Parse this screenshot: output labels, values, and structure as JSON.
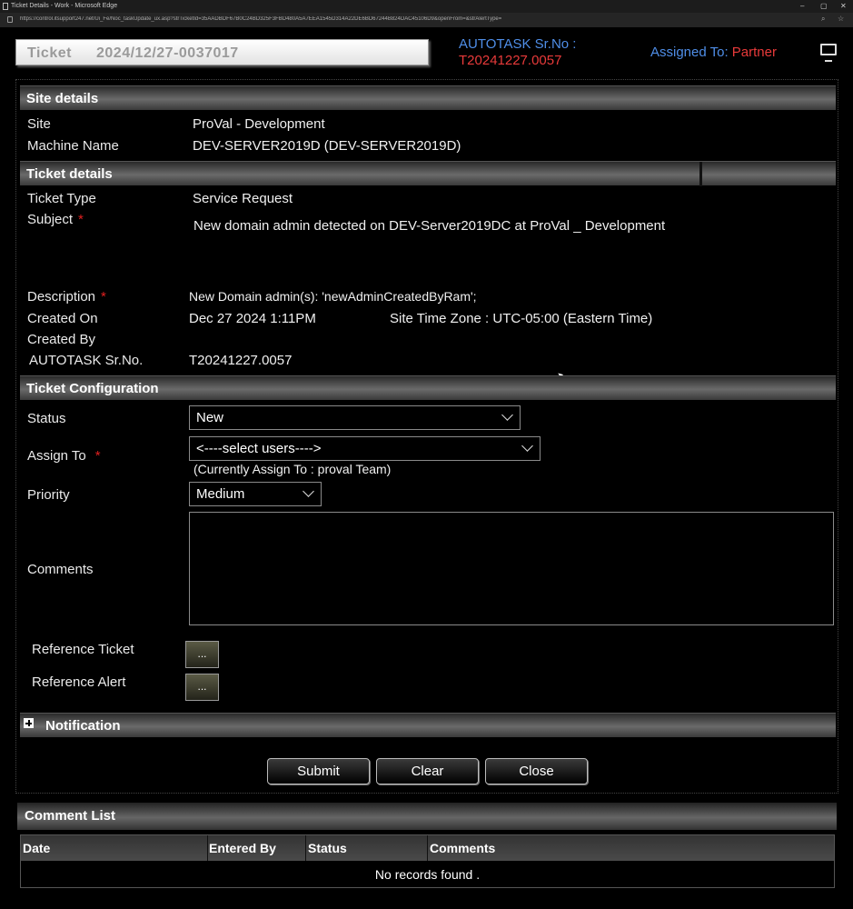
{
  "browser": {
    "window_title": "Ticket Details - Work - Microsoft Edge",
    "url": "https://control.itsupport247.net/Ui_Fe/Noc_taskUpdate_ux.asp?strTicketId=35AADBDF67B0C24BD325F3FBD480A5A7EEA1545D314A22DE6BD67244B824DAC45106D9&openFrom=&strAlertType=",
    "controls": {
      "minimize": "–",
      "maximize": "▢",
      "close": "✕"
    }
  },
  "header": {
    "ticket_label": "Ticket",
    "ticket_number": "2024/12/27-0037017",
    "autotask_label": "AUTOTASK Sr.No :",
    "autotask_value": "T20241227.0057",
    "assigned_label": "Assigned To:",
    "assigned_value": "Partner"
  },
  "site_details": {
    "title": "Site details",
    "site_label": "Site",
    "site_value": "ProVal - Development",
    "machine_label": "Machine Name",
    "machine_value": "DEV-SERVER2019D (DEV-SERVER2019D)"
  },
  "ticket_details": {
    "title": "Ticket details",
    "type_label": "Ticket Type",
    "type_value": "Service Request",
    "subject_label": "Subject",
    "subject_value": "New domain admin detected on DEV-Server2019DC at ProVal _ Development",
    "description_label": "Description",
    "description_value": "New Domain admin(s): 'newAdminCreatedByRam';",
    "created_on_label": "Created On",
    "created_on_value": "Dec 27 2024 1:11PM",
    "timezone_label": "Site Time Zone :",
    "timezone_value": "UTC-05:00 (Eastern Time)",
    "created_by_label": "Created By",
    "created_by_value": "",
    "autotask_label": "AUTOTASK Sr.No.",
    "autotask_value": "T20241227.0057",
    "required_mark": "*"
  },
  "config": {
    "title": "Ticket Configuration",
    "status_label": "Status",
    "status_value": "New",
    "assign_label": "Assign To",
    "assign_value": "<----select users---->",
    "assign_current": "(Currently Assign To : proval Team)",
    "priority_label": "Priority",
    "priority_value": "Medium",
    "comments_label": "Comments",
    "ref_ticket_label": "Reference Ticket",
    "ref_alert_label": "Reference Alert",
    "ellipsis": "..."
  },
  "notification": {
    "title": "Notification"
  },
  "buttons": {
    "submit": "Submit",
    "clear": "Clear",
    "close": "Close"
  },
  "comment_list": {
    "title": "Comment List",
    "columns": [
      "Date",
      "Entered By",
      "Status",
      "Comments"
    ],
    "empty": "No records found ."
  }
}
